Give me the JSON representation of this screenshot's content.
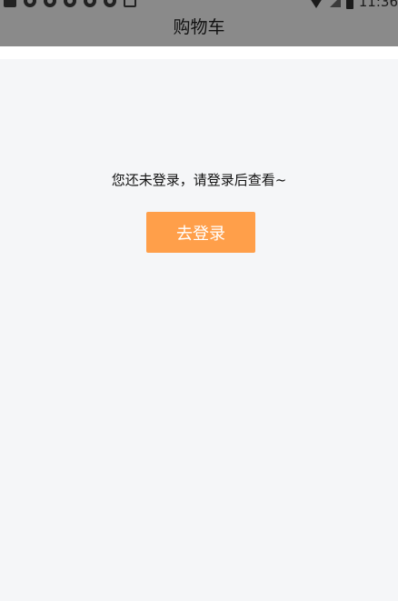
{
  "status_bar": {
    "time": "11:36",
    "icons": [
      "square-icon",
      "notification-icon",
      "notification-icon",
      "notification-icon",
      "notification-icon",
      "notification-icon",
      "message-icon",
      "wifi-icon",
      "signal-icon",
      "battery-icon"
    ]
  },
  "header": {
    "title": "购物车"
  },
  "empty_state": {
    "message": "您还未登录，请登录后查看~",
    "button_label": "去登录"
  },
  "colors": {
    "accent": "#ff9f4a",
    "background": "#f5f6f8",
    "overlay": "#8a8a8a"
  }
}
